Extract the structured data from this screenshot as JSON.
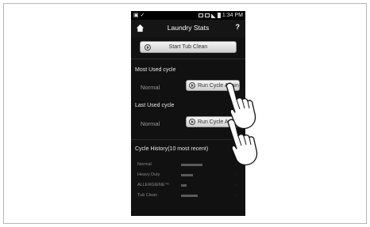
{
  "status_bar": {
    "time": "1:34 PM"
  },
  "header": {
    "title": "Laundry Stats",
    "help": "?"
  },
  "tub_clean": {
    "label": "Start Tub Clean"
  },
  "most_used": {
    "heading": "Most Used cycle",
    "cycle": "Normal",
    "button_label": "Run Cycle Again"
  },
  "last_used": {
    "heading": "Last Used cycle",
    "cycle": "Normal",
    "button_label": "Run Cycle Again"
  },
  "history": {
    "heading": "Cycle History(10 most recent)",
    "rows": [
      {
        "label": "Normal",
        "bar_fraction": 0.45
      },
      {
        "label": "Heavy Duty",
        "bar_fraction": 0.25
      },
      {
        "label": "ALLERGIENE™",
        "bar_fraction": 0.12
      },
      {
        "label": "Tub Clean",
        "bar_fraction": 0.35
      }
    ]
  }
}
